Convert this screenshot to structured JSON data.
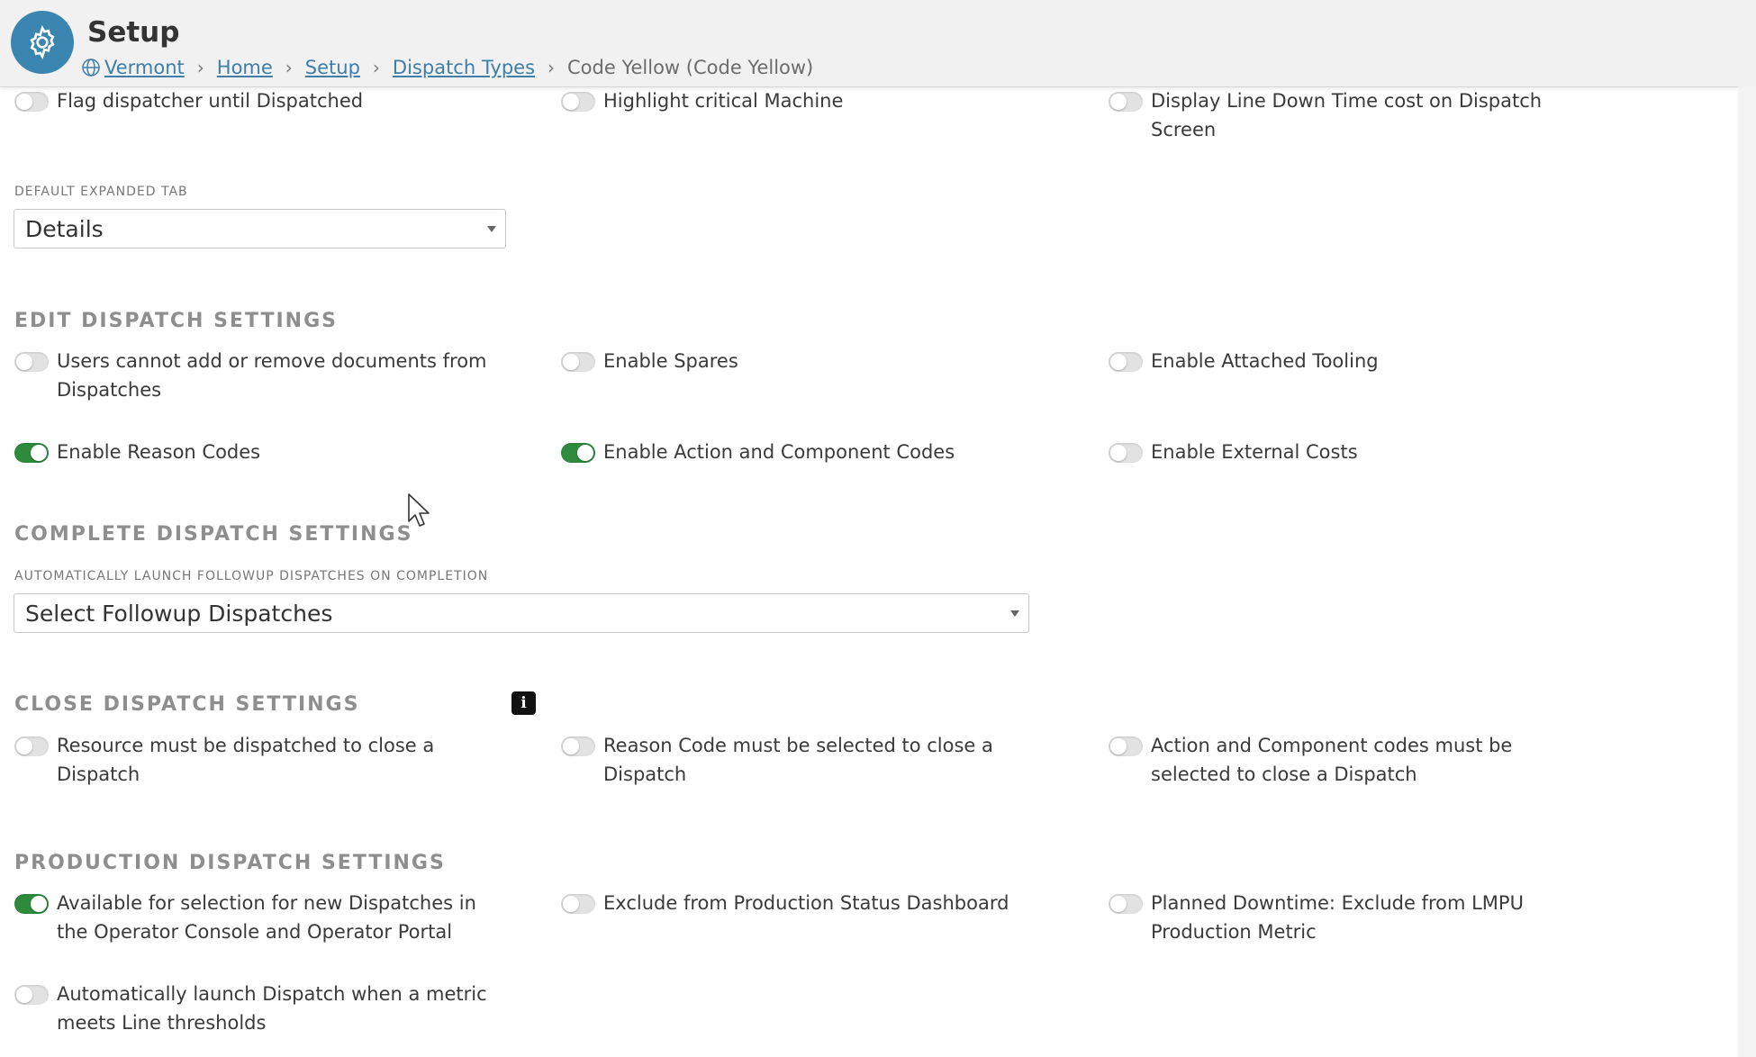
{
  "header": {
    "title": "Setup",
    "breadcrumb": {
      "site": "Vermont",
      "home": "Home",
      "setup": "Setup",
      "dispatch_types": "Dispatch Types",
      "current": "Code Yellow (Code Yellow)",
      "separator": "›"
    }
  },
  "top_toggles": {
    "flag_dispatcher": {
      "label": "Flag dispatcher until Dispatched",
      "on": false
    },
    "highlight_critical": {
      "label": "Highlight critical Machine",
      "on": false
    },
    "display_line_down": {
      "label": "Display Line Down Time cost on Dispatch Screen",
      "on": false
    }
  },
  "default_expanded_tab": {
    "label": "DEFAULT EXPANDED TAB",
    "value": "Details"
  },
  "edit_dispatch": {
    "heading": "EDIT DISPATCH SETTINGS",
    "users_cannot_add": {
      "label": "Users cannot add or remove documents from Dispatches",
      "on": false
    },
    "enable_spares": {
      "label": "Enable Spares",
      "on": false
    },
    "enable_attached_tooling": {
      "label": "Enable Attached Tooling",
      "on": false
    },
    "enable_reason_codes": {
      "label": "Enable Reason Codes",
      "on": true
    },
    "enable_action_component": {
      "label": "Enable Action and Component Codes",
      "on": true
    },
    "enable_external_costs": {
      "label": "Enable External Costs",
      "on": false
    }
  },
  "complete_dispatch": {
    "heading": "COMPLETE DISPATCH SETTINGS",
    "followup_label": "AUTOMATICALLY LAUNCH FOLLOWUP DISPATCHES ON COMPLETION",
    "followup_placeholder": "Select Followup Dispatches"
  },
  "close_dispatch": {
    "heading": "CLOSE DISPATCH SETTINGS",
    "info_glyph": "i",
    "resource_must": {
      "label": "Resource must be dispatched to close a Dispatch",
      "on": false
    },
    "reason_code_must": {
      "label": "Reason Code must be selected to close a Dispatch",
      "on": false
    },
    "action_component_must": {
      "label": "Action and Component codes must be selected to close a Dispatch",
      "on": false
    }
  },
  "production_dispatch": {
    "heading": "PRODUCTION DISPATCH SETTINGS",
    "available_for_selection": {
      "label": "Available for selection for new Dispatches in the Operator Console and Operator Portal",
      "on": true
    },
    "exclude_production_status": {
      "label": "Exclude from Production Status Dashboard",
      "on": false
    },
    "planned_downtime": {
      "label": "Planned Downtime: Exclude from LMPU Production Metric",
      "on": false
    },
    "auto_launch_metric": {
      "label": "Automatically launch Dispatch when a metric meets Line thresholds",
      "on": false
    }
  },
  "colors": {
    "accent": "#3a86b1",
    "toggle_on": "#2e8b3e",
    "toggle_off": "#e2e2e2",
    "link": "#3f7ea8",
    "heading": "#8e8e8e"
  }
}
